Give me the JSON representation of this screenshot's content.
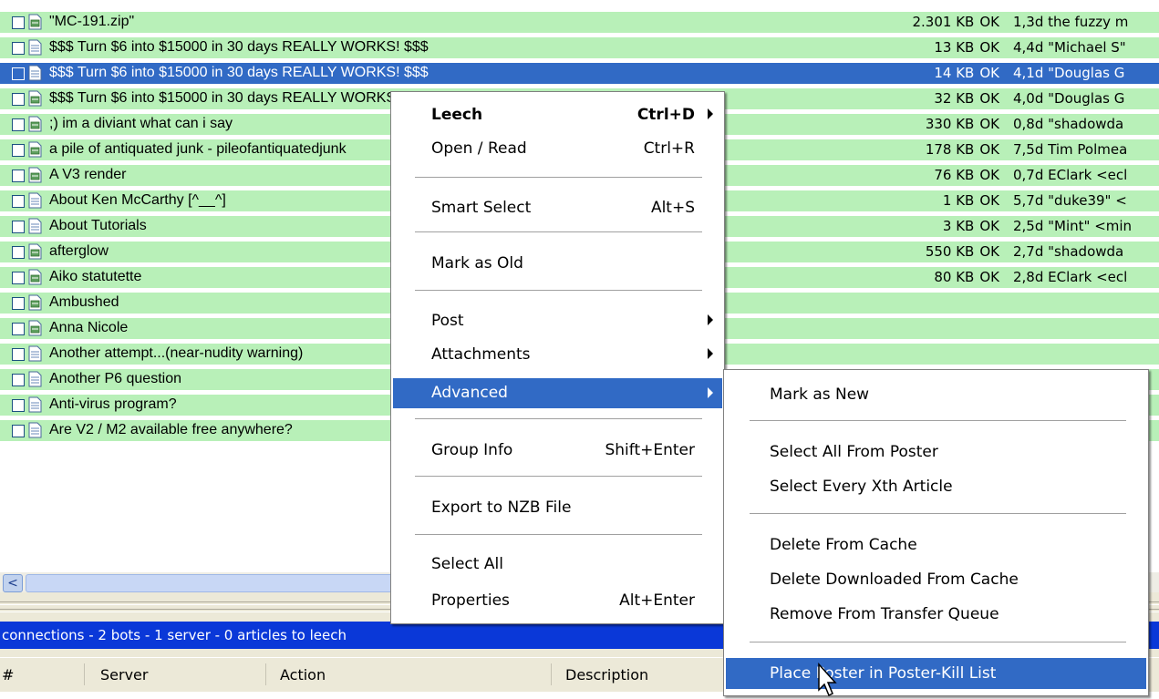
{
  "articles": [
    {
      "subject": "\"MC-191.zip\"",
      "size": "2.301 KB",
      "status": "OK",
      "age_from": "1,3d the fuzzy m",
      "icon": "multipart-icon",
      "selected": false
    },
    {
      "subject": "$$$ Turn $6 into $15000 in 30 days REALLY WORKS! $$$",
      "size": "13 KB",
      "status": "OK",
      "age_from": "4,4d \"Michael S\"",
      "icon": "text-icon",
      "selected": false
    },
    {
      "subject": "$$$ Turn $6 into $15000 in 30 days REALLY WORKS! $$$",
      "size": "14 KB",
      "status": "OK",
      "age_from": "4,1d \"Douglas G",
      "icon": "text-icon",
      "selected": true
    },
    {
      "subject": "$$$ Turn $6 into $15000 in 30 days REALLY WORKS! $$$",
      "size": "32 KB",
      "status": "OK",
      "age_from": "4,0d \"Douglas G",
      "icon": "multipart-icon",
      "selected": false
    },
    {
      "subject": ";) im a diviant what can i say",
      "size": "330 KB",
      "status": "OK",
      "age_from": "0,8d \"shadowda",
      "icon": "multipart-icon",
      "selected": false
    },
    {
      "subject": "a pile of antiquated junk - pileofantiquatedjunk",
      "size": "178 KB",
      "status": "OK",
      "age_from": "7,5d Tim Polmea",
      "icon": "multipart-icon",
      "selected": false
    },
    {
      "subject": "A V3 render",
      "size": "76 KB",
      "status": "OK",
      "age_from": "0,7d EClark <ecl",
      "icon": "multipart-icon",
      "selected": false
    },
    {
      "subject": "About Ken McCarthy [^__^]",
      "size": "1 KB",
      "status": "OK",
      "age_from": "5,7d \"duke39\" <",
      "icon": "text-icon",
      "selected": false
    },
    {
      "subject": "About Tutorials",
      "size": "3 KB",
      "status": "OK",
      "age_from": "2,5d \"Mint\" <min",
      "icon": "text-icon",
      "selected": false
    },
    {
      "subject": "afterglow",
      "size": "550 KB",
      "status": "OK",
      "age_from": "2,7d \"shadowda",
      "icon": "multipart-icon",
      "selected": false
    },
    {
      "subject": "Aiko statutette",
      "size": "80 KB",
      "status": "OK",
      "age_from": "2,8d EClark <ecl",
      "icon": "multipart-icon",
      "selected": false
    },
    {
      "subject": "Ambushed",
      "size": "",
      "status": "",
      "age_from": "",
      "icon": "multipart-icon",
      "selected": false
    },
    {
      "subject": "Anna Nicole",
      "size": "",
      "status": "",
      "age_from": "",
      "icon": "multipart-icon",
      "selected": false
    },
    {
      "subject": "Another attempt...(near-nudity warning)",
      "size": "",
      "status": "",
      "age_from": "",
      "icon": "text-icon",
      "selected": false
    },
    {
      "subject": "Another P6 question",
      "size": "",
      "status": "",
      "age_from": "",
      "icon": "text-icon",
      "selected": false
    },
    {
      "subject": "Anti-virus program?",
      "size": "",
      "status": "",
      "age_from": "",
      "icon": "text-icon",
      "selected": false
    },
    {
      "subject": "Are V2 / M2 available free anywhere?",
      "size": "",
      "status": "",
      "age_from": "",
      "icon": "text-icon",
      "selected": false
    }
  ],
  "status_bar": {
    "text": "connections  -  2 bots  -  1 server  -  0 articles to leech"
  },
  "connections_columns": [
    "#",
    "Server",
    "Action",
    "Description"
  ],
  "scroll_left_glyph": "<",
  "context_menu": {
    "items": [
      {
        "label": "Leech",
        "shortcut": "Ctrl+D",
        "submenu": true,
        "bold": true
      },
      {
        "label": "Open / Read",
        "shortcut": "Ctrl+R"
      },
      {
        "label": "Smart Select",
        "shortcut": "Alt+S"
      },
      {
        "label": "Mark as Old",
        "shortcut": ""
      },
      {
        "label": "Post",
        "shortcut": "",
        "submenu": true
      },
      {
        "label": "Attachments",
        "shortcut": "",
        "submenu": true
      },
      {
        "label": "Advanced",
        "shortcut": "",
        "submenu": true,
        "highlighted": true
      },
      {
        "label": "Group Info",
        "shortcut": "Shift+Enter"
      },
      {
        "label": "Export to NZB File",
        "shortcut": ""
      },
      {
        "label": "Select All",
        "shortcut": ""
      },
      {
        "label": "Properties",
        "shortcut": "Alt+Enter"
      }
    ]
  },
  "advanced_submenu": {
    "items": [
      {
        "label": "Mark as New"
      },
      {
        "label": "Select All From Poster"
      },
      {
        "label": "Select Every Xth Article"
      },
      {
        "label": "Delete From Cache"
      },
      {
        "label": "Delete Downloaded From Cache"
      },
      {
        "label": "Remove From Transfer Queue"
      },
      {
        "label": "Place Poster in Poster-Kill List",
        "highlighted": true
      }
    ]
  },
  "colors": {
    "row_bg": "#b8f0b8",
    "selection": "#316ac5",
    "status_bg": "#0a38d8"
  }
}
